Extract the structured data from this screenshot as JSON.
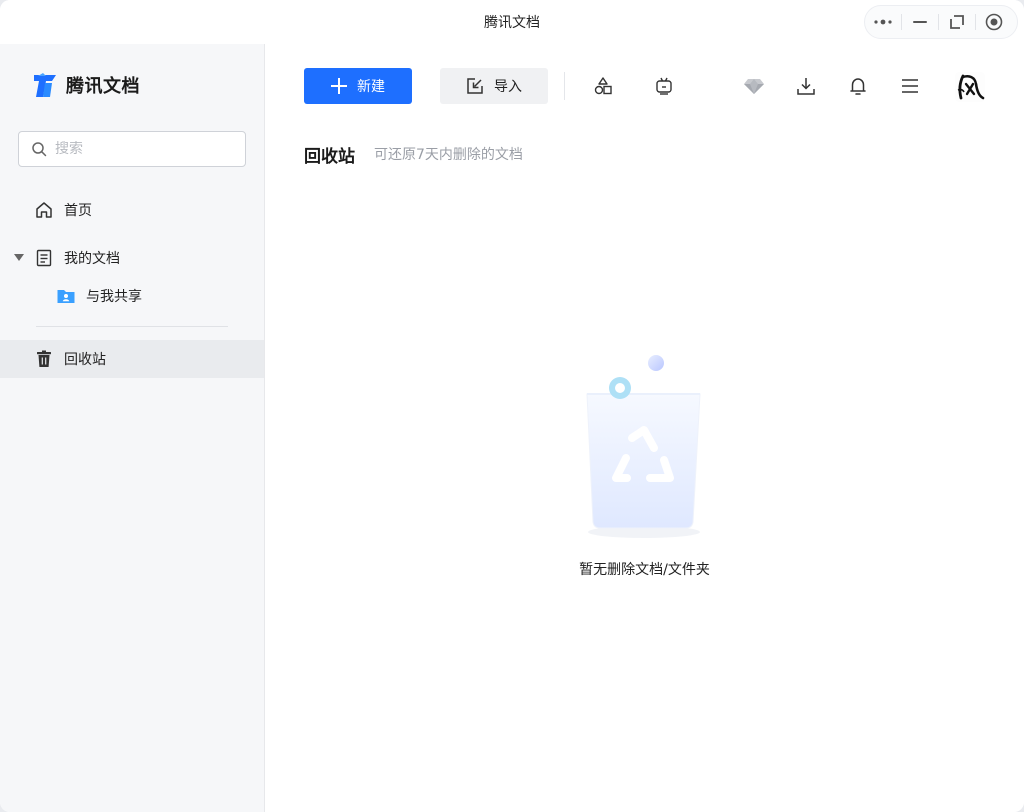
{
  "window": {
    "title": "腾讯文档",
    "controls": [
      "more-icon",
      "minimize-icon",
      "restore-icon",
      "close-icon"
    ]
  },
  "sidebar": {
    "logo_text": "腾讯文档",
    "search": {
      "placeholder": "搜索",
      "value": ""
    },
    "items": [
      {
        "label": "首页",
        "icon": "home-icon"
      },
      {
        "label": "我的文档",
        "icon": "document-icon",
        "expanded": true
      },
      {
        "label": "与我共享",
        "icon": "shared-folder-icon"
      },
      {
        "label": "回收站",
        "icon": "trash-icon",
        "active": true
      }
    ]
  },
  "toolbar": {
    "new_label": "新建",
    "import_label": "导入",
    "icons": [
      "templates-icon",
      "tv-icon",
      "premium-diamond-icon",
      "download-icon",
      "bell-icon",
      "menu-icon"
    ]
  },
  "main": {
    "title": "回收站",
    "subtitle": "可还原7天内删除的文档",
    "empty_text": "暂无删除文档/文件夹"
  },
  "colors": {
    "accent": "#1e6fff",
    "sidebar_bg": "#f6f7f9",
    "active_item_bg": "#e9ebee"
  }
}
